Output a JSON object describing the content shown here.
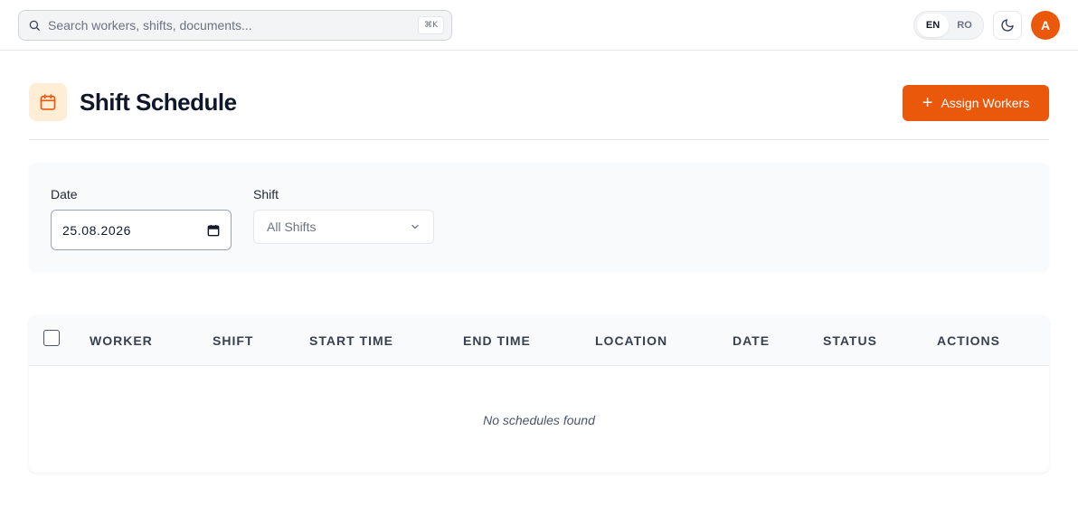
{
  "search": {
    "placeholder": "Search workers, shifts, documents...",
    "shortcut": "⌘K"
  },
  "language": {
    "options": [
      "EN",
      "RO"
    ],
    "active": "EN"
  },
  "user": {
    "initial": "A"
  },
  "header": {
    "title": "Shift Schedule",
    "assign_label": "Assign Workers"
  },
  "filters": {
    "date_label": "Date",
    "date_value": "25.08.2026",
    "shift_label": "Shift",
    "shift_value": "All Shifts"
  },
  "table": {
    "columns": [
      "WORKER",
      "SHIFT",
      "START TIME",
      "END TIME",
      "LOCATION",
      "DATE",
      "STATUS",
      "ACTIONS"
    ],
    "empty_message": "No schedules found"
  },
  "colors": {
    "accent": "#ea580c",
    "accent_light": "#ffedd5"
  }
}
